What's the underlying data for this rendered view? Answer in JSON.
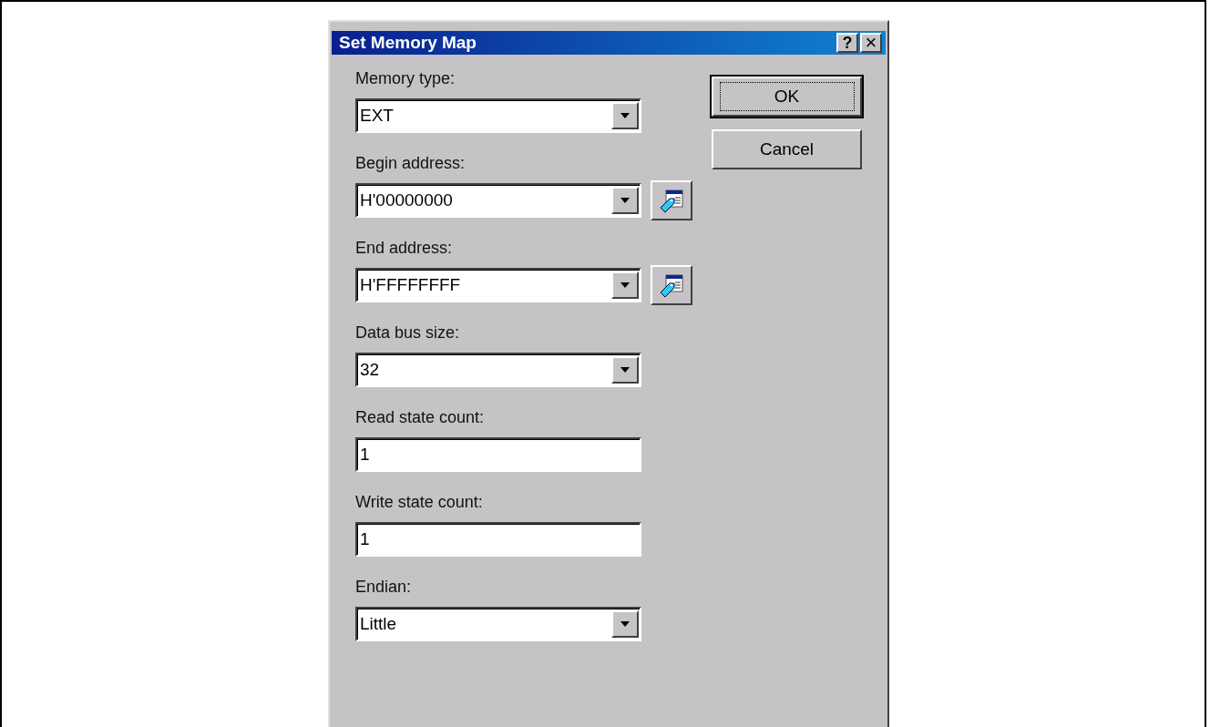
{
  "window": {
    "title": "Set Memory Map",
    "title_buttons": [
      {
        "kind": "help",
        "label": "?"
      },
      {
        "kind": "close",
        "label": "×"
      }
    ]
  },
  "fields": [
    {
      "label": "Memory type:",
      "kind": "combo",
      "value": "EXT",
      "picker": false
    },
    {
      "label": "Begin address:",
      "kind": "combo",
      "value": "H'00000000",
      "picker": true
    },
    {
      "label": "End address:",
      "kind": "combo",
      "value": "H'FFFFFFFF",
      "picker": true
    },
    {
      "label": "Data bus size:",
      "kind": "combo",
      "value": "32",
      "picker": false
    },
    {
      "label": "Read state count:",
      "kind": "text",
      "value": "1",
      "picker": false
    },
    {
      "label": "Write state count:",
      "kind": "text",
      "value": "1",
      "picker": false
    },
    {
      "label": "Endian:",
      "kind": "combo",
      "value": "Little",
      "picker": false
    }
  ],
  "buttons": [
    {
      "label": "OK",
      "default": true
    },
    {
      "label": "Cancel",
      "default": false
    }
  ]
}
